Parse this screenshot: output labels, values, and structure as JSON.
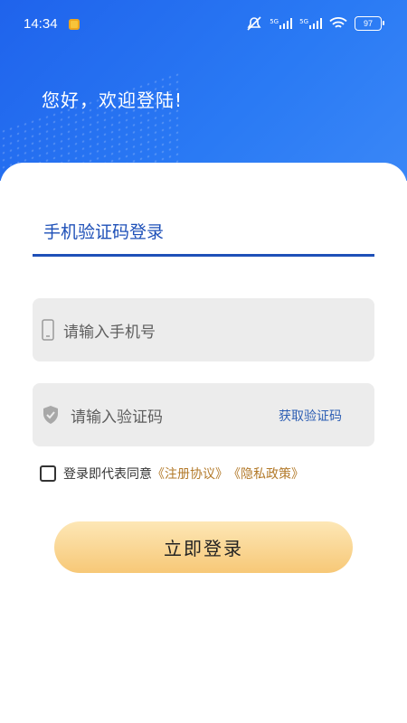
{
  "status_bar": {
    "time": "14:34",
    "signal1_label": "5G",
    "signal2_label": "5G",
    "battery": "97"
  },
  "header": {
    "greeting": "您好，欢迎登陆!"
  },
  "login": {
    "tab_label": "手机验证码登录",
    "phone_placeholder": "请输入手机号",
    "code_placeholder": "请输入验证码",
    "get_code_label": "获取验证码",
    "agreement_prefix": "登录即代表同意",
    "user_agreement": "《注册协议》",
    "privacy_policy": "《隐私政策》",
    "submit_label": "立即登录"
  },
  "colors": {
    "header_blue": "#1f63ec",
    "tab_blue": "#1e50b8",
    "link_gold": "#b37a2a",
    "button_gold": "#f7c877"
  }
}
